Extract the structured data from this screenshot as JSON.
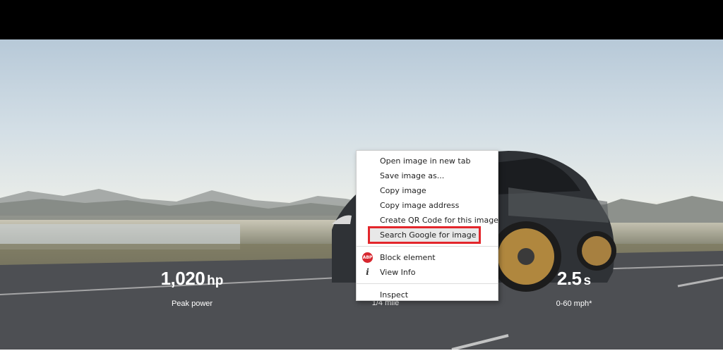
{
  "stats": [
    {
      "value": "1,020",
      "unit": "hp",
      "label": "Peak power"
    },
    {
      "value": "",
      "unit": "",
      "label": "1/4 mile"
    },
    {
      "value": "2.5",
      "unit": "s",
      "label": "0-60 mph*"
    }
  ],
  "context_menu": {
    "items": [
      {
        "label": "Open image in new tab",
        "icon": ""
      },
      {
        "label": "Save image as...",
        "icon": ""
      },
      {
        "label": "Copy image",
        "icon": ""
      },
      {
        "label": "Copy image address",
        "icon": ""
      },
      {
        "label": "Create QR Code for this image",
        "icon": ""
      },
      {
        "label": "Search Google for image",
        "icon": "",
        "highlighted": true
      }
    ],
    "extension_items": [
      {
        "label": "Block element",
        "icon": "adblock-plus-icon",
        "icon_text": "ABP"
      },
      {
        "label": "View Info",
        "icon": "info-icon",
        "icon_text": "i"
      }
    ],
    "dev_items": [
      {
        "label": "Inspect"
      }
    ]
  },
  "colors": {
    "highlight_border": "#e3262b",
    "top_bar": "#000000"
  }
}
